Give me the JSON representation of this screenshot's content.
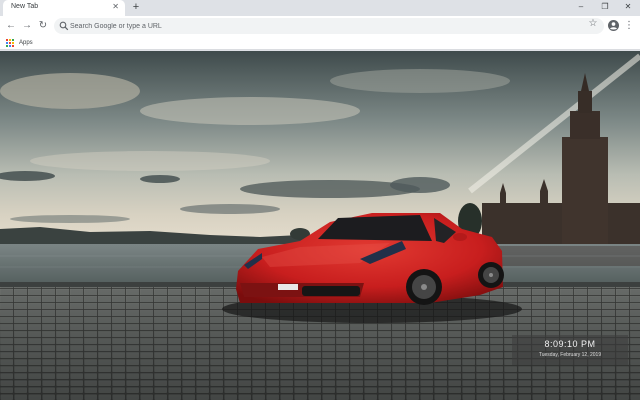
{
  "tab": {
    "title": "New Tab"
  },
  "toolbar": {
    "omnibox_placeholder": "Search Google or type a URL"
  },
  "bookmarks": {
    "apps_label": "Apps"
  },
  "clock": {
    "time": "8:09:10 PM",
    "date": "Tuesday, February 12, 2019"
  },
  "icons": {
    "close": "close-icon",
    "new_tab": "plus-icon",
    "minimize": "minimize-icon",
    "restore": "restore-icon",
    "window_close": "close-icon",
    "back": "back-arrow-icon",
    "forward": "forward-arrow-icon",
    "reload": "reload-icon",
    "search": "search-icon",
    "bookmark": "star-icon",
    "profile": "account-icon",
    "menu": "more-vert-icon",
    "apps": "apps-grid-icon"
  },
  "colors": {
    "car": "#c81e1e",
    "apps_dots": [
      "#ea4335",
      "#fbbc05",
      "#34a853",
      "#4285f4"
    ]
  }
}
